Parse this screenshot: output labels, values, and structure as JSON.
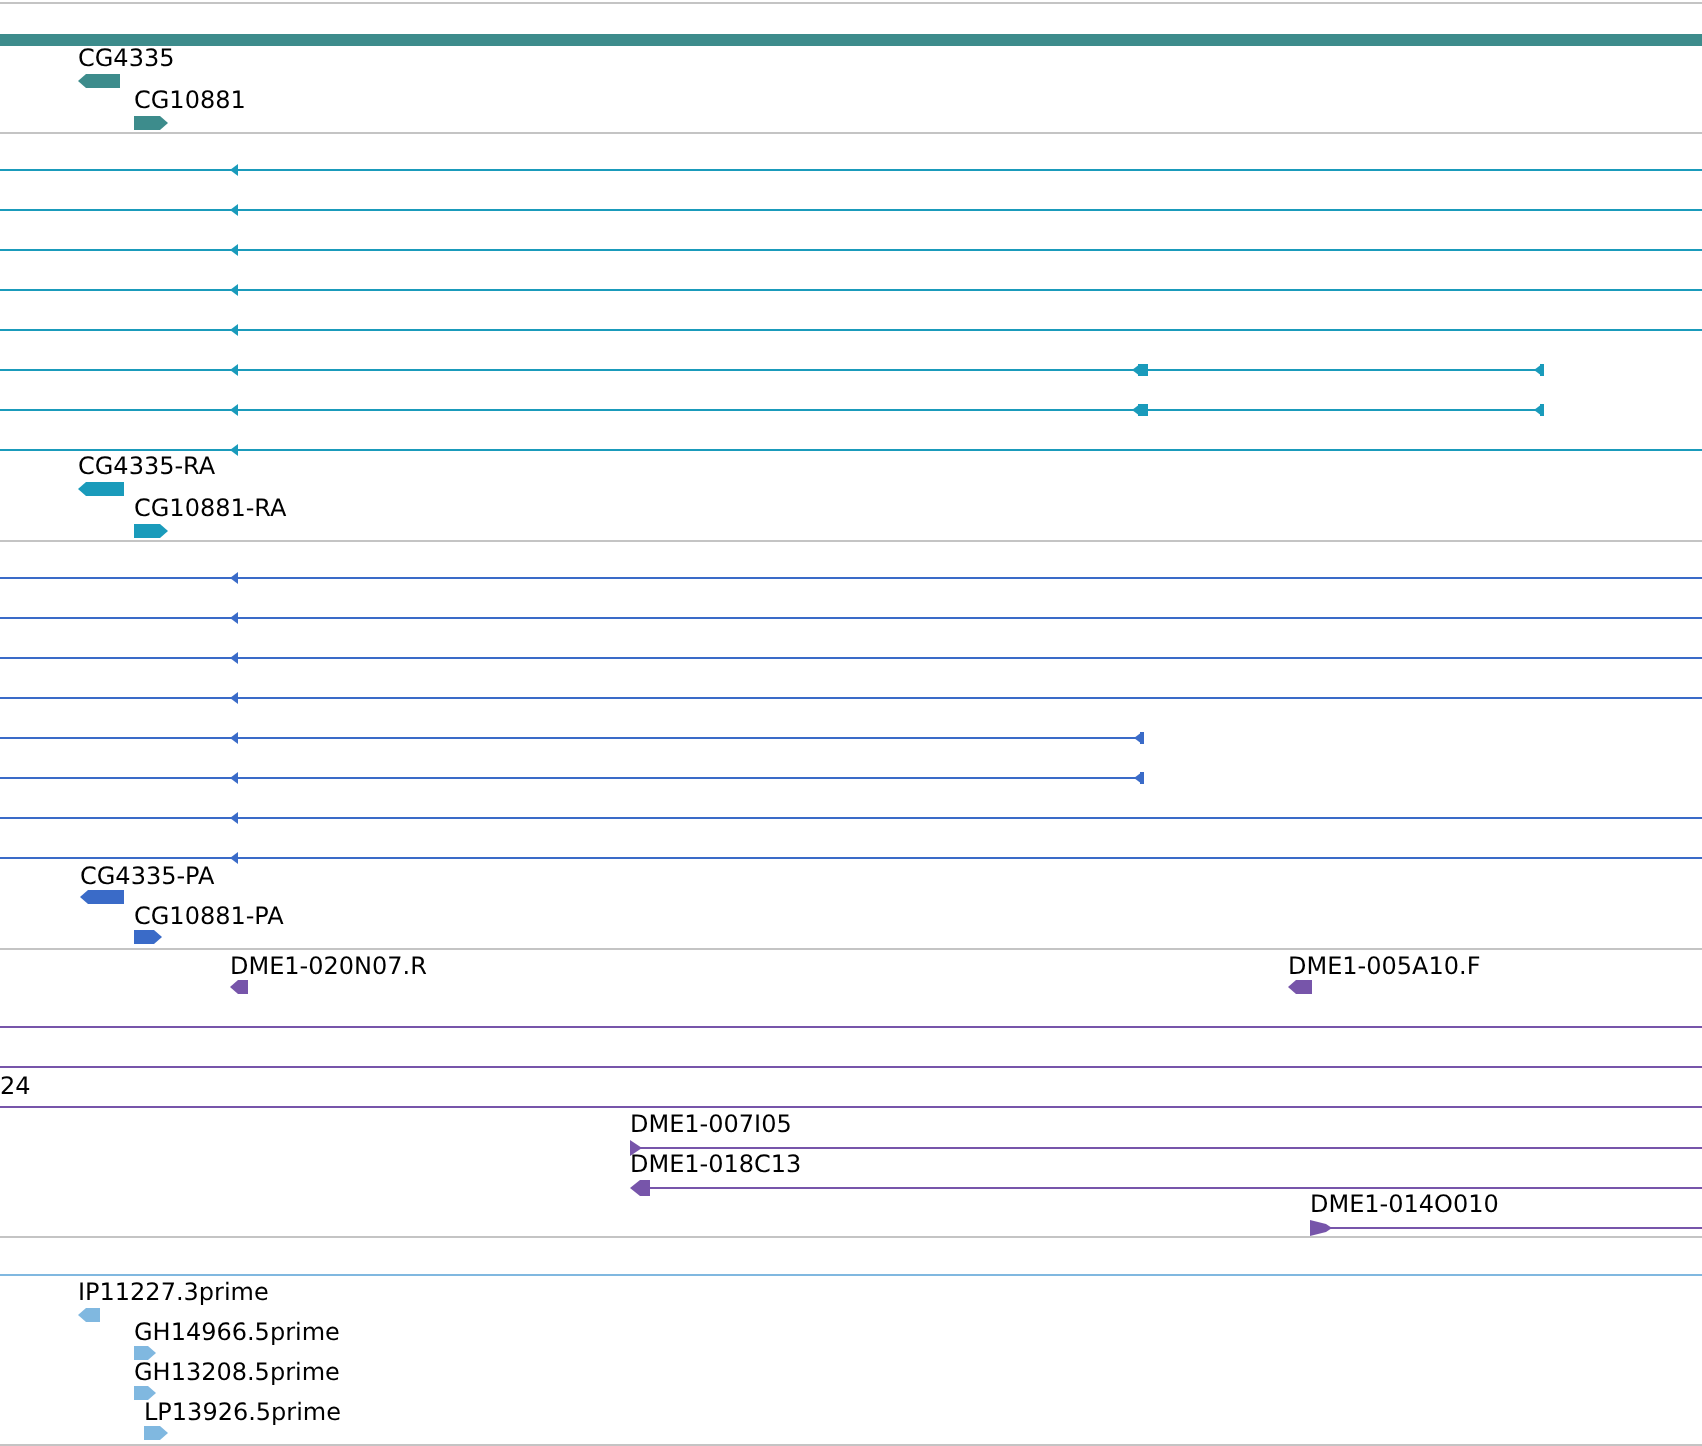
{
  "tracks": [
    {
      "kind": "gene",
      "color": "#3d8c8c",
      "features": [
        {
          "label": "CG4335",
          "reverse": true,
          "kind": "block"
        },
        {
          "label": "CG10881",
          "reverse": false,
          "kind": "block"
        }
      ]
    },
    {
      "kind": "transcript",
      "color": "#1a9bbb",
      "alignments": [
        {
          "kind": "full"
        },
        {
          "kind": "full"
        },
        {
          "kind": "full"
        },
        {
          "kind": "full"
        },
        {
          "kind": "full"
        },
        {
          "kind": "split"
        },
        {
          "kind": "split"
        },
        {
          "kind": "full"
        }
      ],
      "features": [
        {
          "label": "CG4335-RA",
          "reverse": true,
          "kind": "block"
        },
        {
          "label": "CG10881-RA",
          "reverse": false,
          "kind": "block"
        }
      ]
    },
    {
      "kind": "transcript",
      "color": "#3a6bc8",
      "alignments": [
        {
          "kind": "full"
        },
        {
          "kind": "full"
        },
        {
          "kind": "full"
        },
        {
          "kind": "full"
        },
        {
          "kind": "short"
        },
        {
          "kind": "short"
        },
        {
          "kind": "full"
        },
        {
          "kind": "full"
        }
      ],
      "features": [
        {
          "label": "CG4335-PA",
          "reverse": true,
          "kind": "block"
        },
        {
          "label": "CG10881-PA",
          "reverse": false,
          "kind": "block"
        }
      ]
    },
    {
      "kind": "clone",
      "color": "#7755aa",
      "fragment": "24",
      "features": [
        {
          "label": "DME1-020N07.R",
          "reverse": true,
          "kind": "block"
        },
        {
          "label": "DME1-005A10.F",
          "reverse": true,
          "kind": "block"
        },
        {
          "label": "DME1-007I05",
          "reverse": false,
          "kind": "line"
        },
        {
          "label": "DME1-018C13",
          "reverse": true,
          "kind": "line"
        },
        {
          "label": "DME1-014O010",
          "reverse": false,
          "kind": "line"
        }
      ]
    },
    {
      "kind": "est",
      "color": "#80b8e0",
      "features": [
        {
          "label": "IP11227.3prime",
          "reverse": true,
          "kind": "block"
        },
        {
          "label": "GH14966.5prime",
          "reverse": false,
          "kind": "block"
        },
        {
          "label": "GH13208.5prime",
          "reverse": false,
          "kind": "block"
        },
        {
          "label": "LP13926.5prime",
          "reverse": false,
          "kind": "block"
        }
      ]
    }
  ]
}
